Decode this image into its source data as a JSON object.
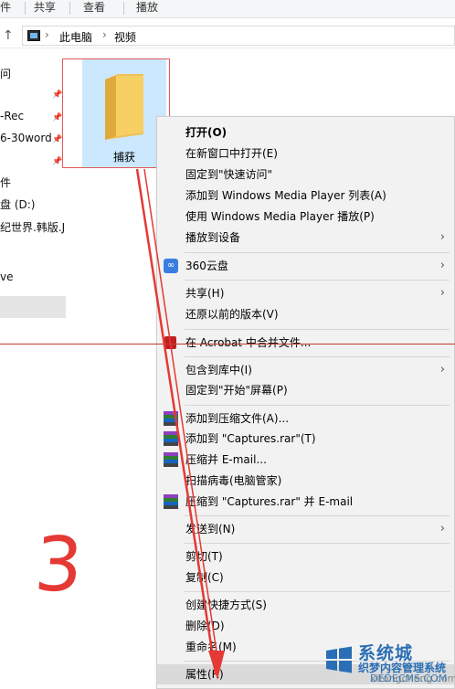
{
  "ribbon": {
    "tabs": [
      "件",
      "共享",
      "查看",
      "播放"
    ]
  },
  "address": {
    "up_glyph": "↑",
    "crumbs": [
      "此电脑",
      "视频"
    ],
    "chevron": "›"
  },
  "nav": {
    "items": [
      "问",
      "-Rec",
      "6-30word",
      "件",
      "盘 (D:)",
      "纪世界.韩版.Ju",
      "ve"
    ]
  },
  "folder": {
    "label": "捕获"
  },
  "context_menu": {
    "items": [
      {
        "label": "打开(O)"
      },
      {
        "label": "在新窗口中打开(E)"
      },
      {
        "label": "固定到\"快速访问\""
      },
      {
        "label": "添加到 Windows Media Player 列表(A)"
      },
      {
        "label": "使用 Windows Media Player 播放(P)"
      },
      {
        "label": "播放到设备"
      },
      {
        "label": "360云盘"
      },
      {
        "label": "共享(H)"
      },
      {
        "label": "还原以前的版本(V)"
      },
      {
        "label": "在 Acrobat 中合并文件..."
      },
      {
        "label": "包含到库中(I)"
      },
      {
        "label": "固定到\"开始\"屏幕(P)"
      },
      {
        "label": "添加到压缩文件(A)..."
      },
      {
        "label": "添加到 \"Captures.rar\"(T)"
      },
      {
        "label": "压缩并 E-mail..."
      },
      {
        "label": "扫描病毒(电脑管家)"
      },
      {
        "label": "压缩到 \"Captures.rar\" 并 E-mail"
      },
      {
        "label": "发送到(N)"
      },
      {
        "label": "剪切(T)"
      },
      {
        "label": "复制(C)"
      },
      {
        "label": "创建快捷方式(S)"
      },
      {
        "label": "删除(D)"
      },
      {
        "label": "重命名(M)"
      },
      {
        "label": "属性(R)"
      }
    ],
    "submenu_glyph": "›",
    "icon_360_text": "∞"
  },
  "annotation": {
    "step_number": "3"
  },
  "watermark": {
    "brand": "系统城",
    "subtitle": "织梦内容管理系统",
    "domain_back": "xitongcheng.com",
    "domain_front": "DEDECMS.COM"
  },
  "colors": {
    "annotation_red": "#e53935",
    "selection_blue": "#cce8ff",
    "menu_bg": "#f2f2f2",
    "menu_hover": "#dadada",
    "watermark_blue": "#2a6fb5"
  }
}
